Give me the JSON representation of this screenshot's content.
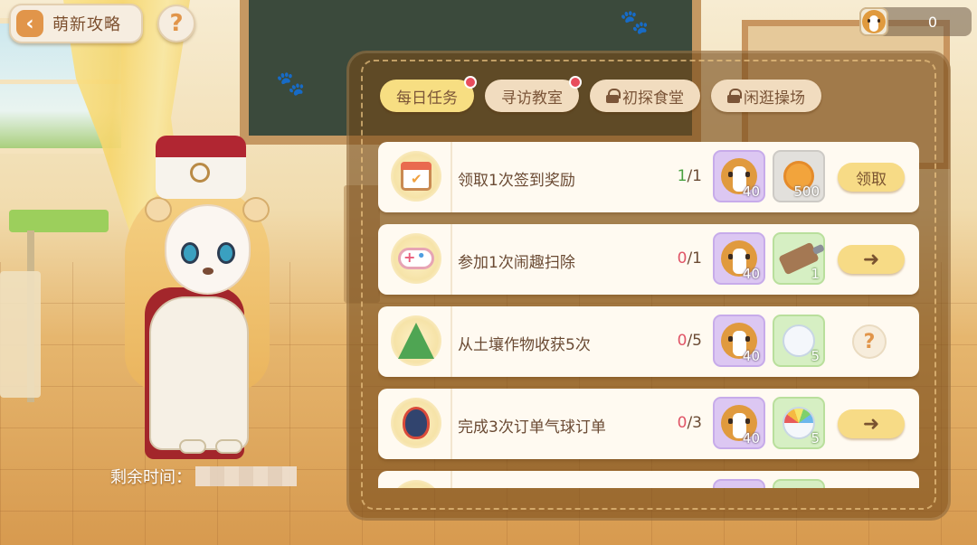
{
  "header": {
    "guide_label": "萌新攻略",
    "back_icon": "chevron-left-icon",
    "help_symbol": "?",
    "currency_icon": "dog-face-icon",
    "currency_amount": "0"
  },
  "character": {
    "remaining_time_label": "剩余时间："
  },
  "tabs": [
    {
      "label": "每日任务",
      "active": true,
      "notification": true,
      "locked": false
    },
    {
      "label": "寻访教室",
      "active": false,
      "notification": true,
      "locked": false
    },
    {
      "label": "初探食堂",
      "active": false,
      "notification": false,
      "locked": true
    },
    {
      "label": "闲逛操场",
      "active": false,
      "notification": false,
      "locked": true
    }
  ],
  "tasks": [
    {
      "icon": "calendar-check-icon",
      "title": "领取1次签到奖励",
      "progress_current": "1",
      "progress_total": "/1",
      "rewards": [
        {
          "icon": "dog-face-icon",
          "qty": "40",
          "bg": "purple"
        },
        {
          "icon": "gold-coin-icon",
          "qty": "500",
          "bg": "grey"
        }
      ],
      "action": {
        "type": "claim",
        "label": "领取"
      }
    },
    {
      "icon": "gamepad-icon",
      "title": "参加1次闹趣扫除",
      "progress_current": "0",
      "progress_total": "/1",
      "rewards": [
        {
          "icon": "dog-face-icon",
          "qty": "40",
          "bg": "purple"
        },
        {
          "icon": "shovel-icon",
          "qty": "1",
          "bg": "green"
        }
      ],
      "action": {
        "type": "go",
        "label": "➜"
      }
    },
    {
      "icon": "tree-cow-icon",
      "title": "从土壤作物收获5次",
      "progress_current": "0",
      "progress_total": "/5",
      "rewards": [
        {
          "icon": "dog-face-icon",
          "qty": "40",
          "bg": "purple"
        },
        {
          "icon": "seed-bag-icon",
          "qty": "5",
          "bg": "green"
        }
      ],
      "action": {
        "type": "help",
        "label": "?"
      }
    },
    {
      "icon": "hot-air-balloon-icon",
      "title": "完成3次订单气球订单",
      "progress_current": "0",
      "progress_total": "/3",
      "rewards": [
        {
          "icon": "dog-face-icon",
          "qty": "40",
          "bg": "purple"
        },
        {
          "icon": "rainbow-seed-icon",
          "qty": "5",
          "bg": "green"
        }
      ],
      "action": {
        "type": "go",
        "label": "➜"
      }
    }
  ],
  "colors": {
    "accent_yellow": "#f7db86",
    "progress_incomplete": "#e05567",
    "progress_complete": "#4aa140",
    "panel_bg": "#764a1a"
  }
}
